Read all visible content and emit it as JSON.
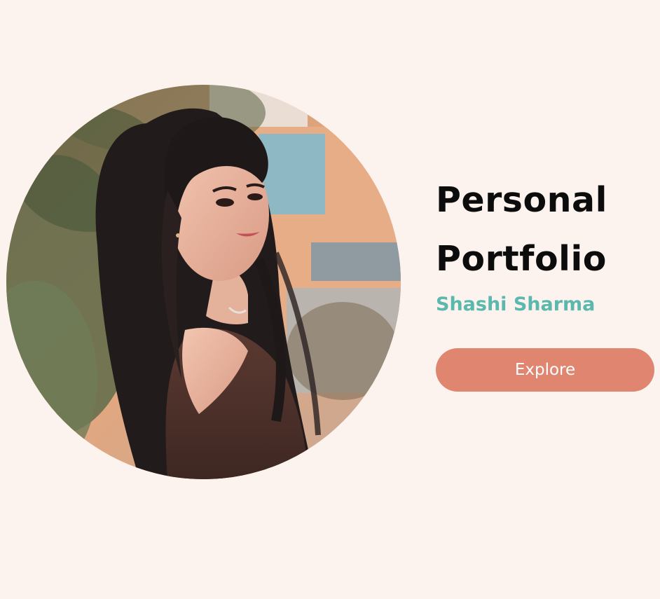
{
  "hero": {
    "title_line1": "Personal",
    "title_line2": "Portfolio",
    "name": "Shashi Sharma",
    "button_label": "Explore"
  },
  "colors": {
    "background": "#fcf3ee",
    "accent_name": "#5bb8ad",
    "button": "#df8570",
    "title": "#0c0c0c"
  }
}
